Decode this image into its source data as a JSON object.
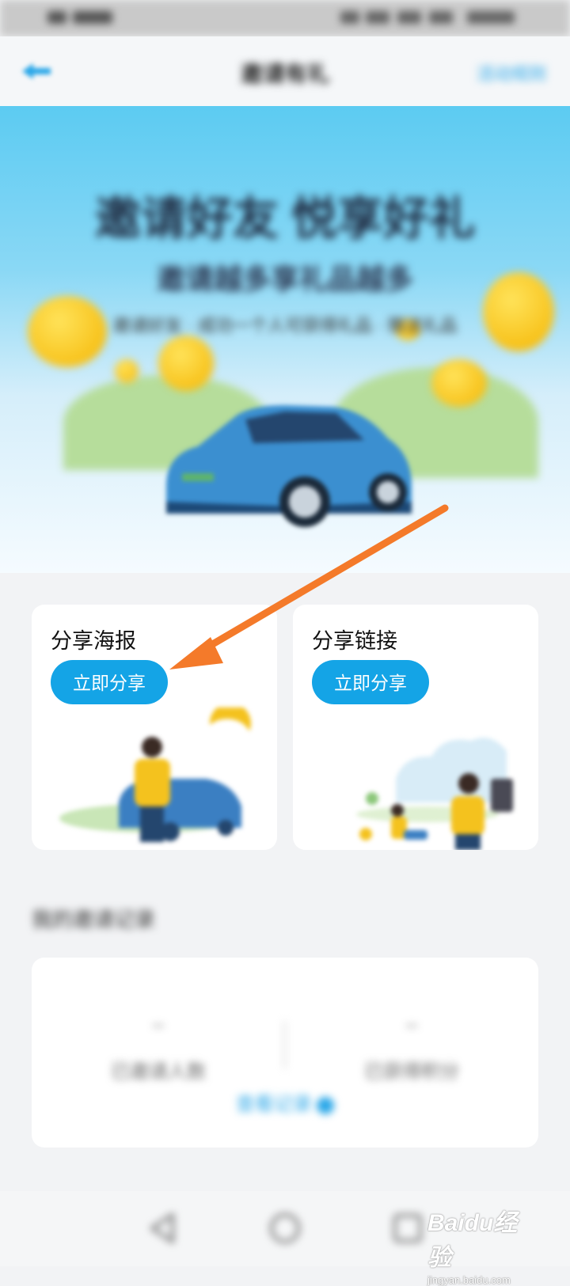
{
  "status_bar": {},
  "nav": {
    "title": "邀请有礼",
    "rules_label": "活动规则"
  },
  "hero": {
    "title": "邀请好友 悦享好礼",
    "subtitle": "邀请越多享礼品越多",
    "description": "邀请好友 · 成功一个人可获得礼品 · 赠送礼品"
  },
  "share_cards": [
    {
      "title": "分享海报",
      "button_label": "立即分享"
    },
    {
      "title": "分享链接",
      "button_label": "立即分享"
    }
  ],
  "records": {
    "section_title": "我的邀请记录",
    "stats": [
      {
        "value": "--",
        "label": "已邀请人数"
      },
      {
        "value": "--",
        "label": "已获得积分"
      }
    ],
    "link_label": "查看记录"
  },
  "bottom_nav": {},
  "watermark": {
    "logo": "Baidu经验",
    "url": "jingyan.baidu.com"
  },
  "colors": {
    "accent": "#14a4e6",
    "arrow": "#f47a2a",
    "coin": "#f4b400"
  }
}
